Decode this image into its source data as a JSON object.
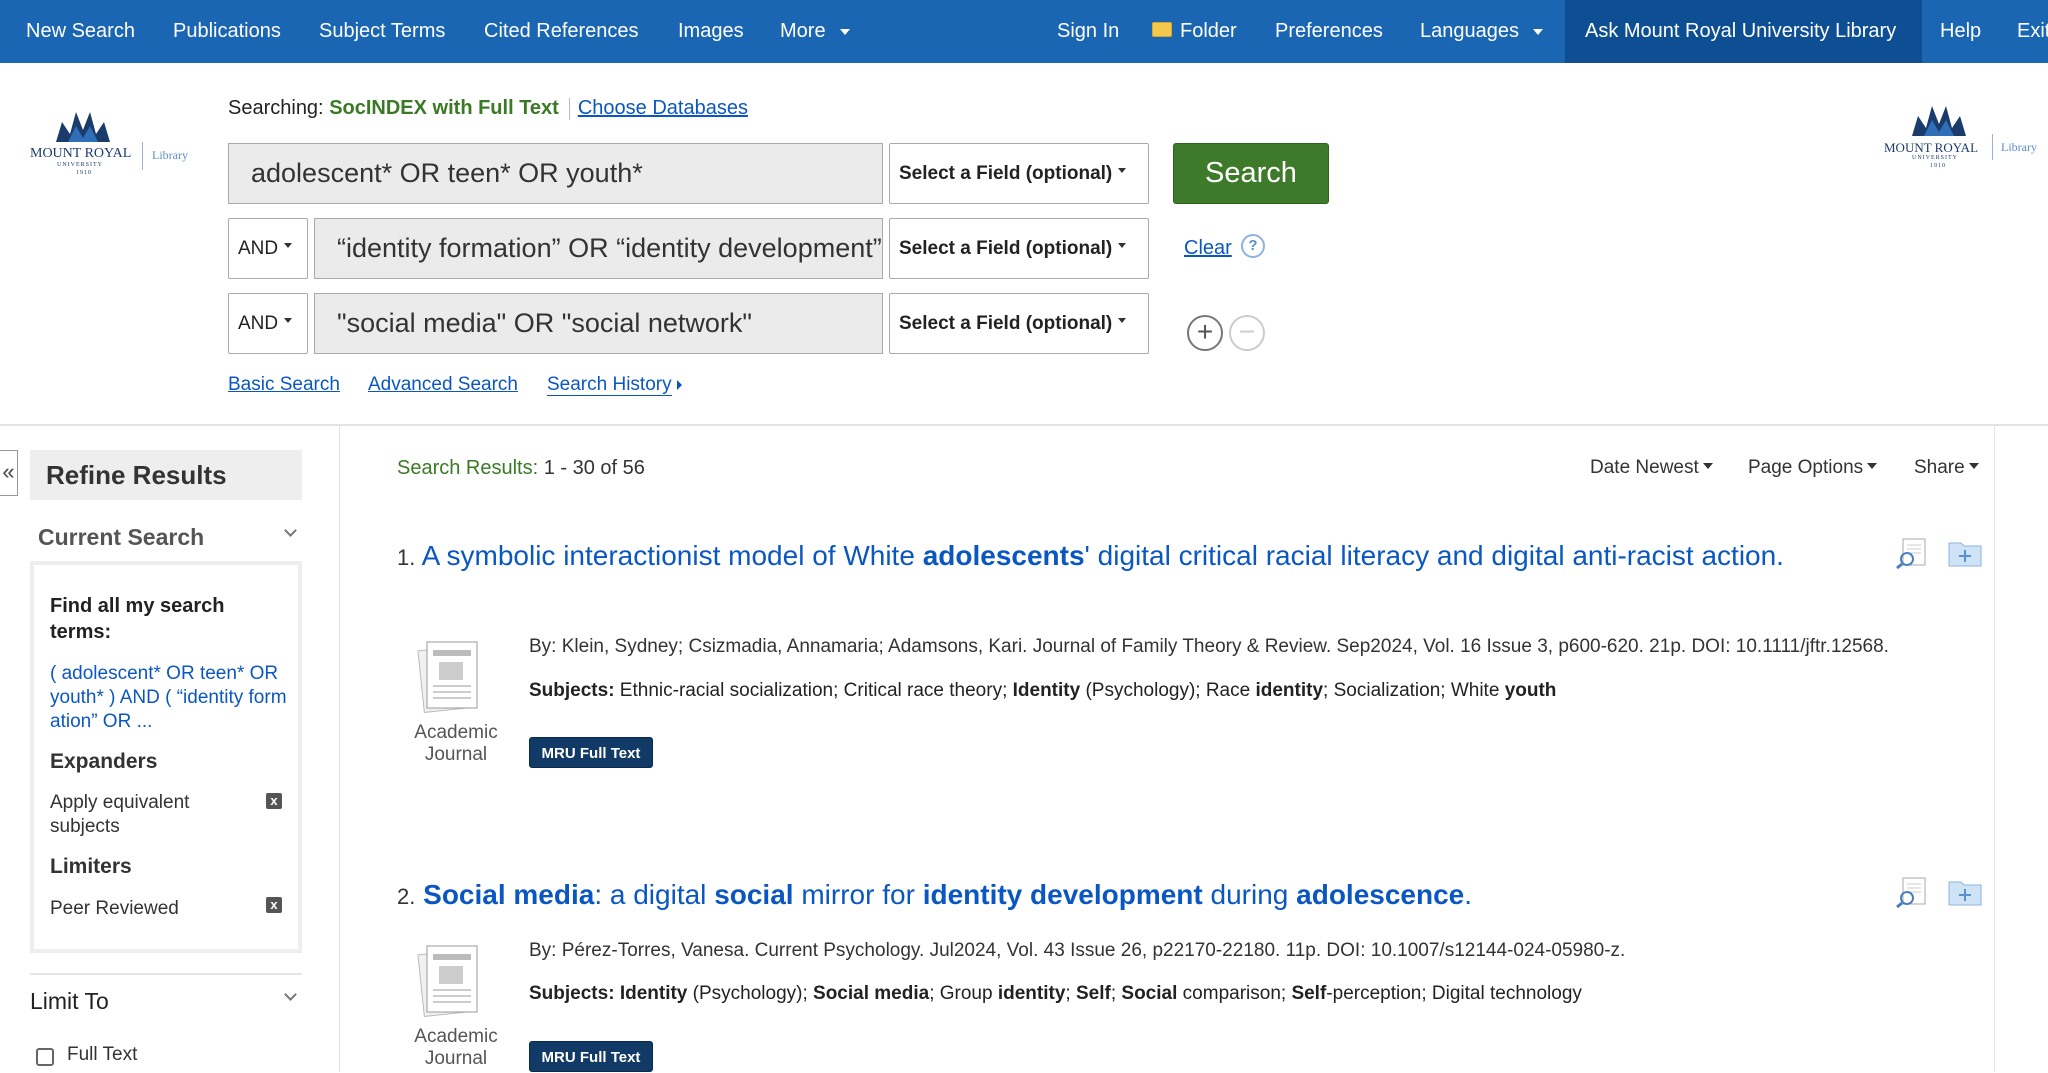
{
  "nav": {
    "left": [
      "New Search",
      "Publications",
      "Subject Terms",
      "Cited References",
      "Images",
      "More"
    ],
    "sign_in": "Sign In",
    "folder": "Folder",
    "preferences": "Preferences",
    "languages": "Languages",
    "ask": "Ask Mount Royal University Library",
    "help": "Help",
    "exit": "Exit"
  },
  "logo": {
    "name": "MOUNT ROYAL",
    "sub": "UNIVERSITY",
    "year": "1910",
    "library": "Library"
  },
  "search": {
    "searching_label": "Searching:",
    "database": "SocINDEX with Full Text",
    "choose_db": "Choose Databases",
    "rows": [
      {
        "bool": "",
        "query": "adolescent* OR teen* OR youth*",
        "field": "Select a Field (optional)"
      },
      {
        "bool": "AND",
        "query": "“identity formation” OR “identity development”",
        "field": "Select a Field (optional)"
      },
      {
        "bool": "AND",
        "query": "\"social media\" OR \"social network\"",
        "field": "Select a Field (optional)"
      }
    ],
    "search_button": "Search",
    "clear": "Clear",
    "help_mark": "?",
    "links": {
      "basic": "Basic Search",
      "advanced": "Advanced Search",
      "history": "Search History"
    }
  },
  "refine": {
    "collapse": "«",
    "title": "Refine Results",
    "current_search": "Current Search",
    "find_all_label": "Find all my search terms:",
    "query_summary": "( adolescent* OR teen* OR youth* ) AND ( “identity formation” OR ...",
    "expanders_label": "Expanders",
    "expander": "Apply equivalent subjects",
    "limiters_label": "Limiters",
    "limiter": "Peer Reviewed",
    "remove_mark": "x",
    "limit_to": "Limit To",
    "full_text": "Full Text"
  },
  "results": {
    "count_label": "Search Results:",
    "count": "1 - 30 of 56",
    "sort": "Date Newest",
    "page_options": "Page Options",
    "share": "Share",
    "items": [
      {
        "num": "1.",
        "title_parts": [
          {
            "t": "A symbolic interactionist model of White ",
            "b": false
          },
          {
            "t": "adolescents",
            "b": true
          },
          {
            "t": "' digital critical racial literacy and digital anti-racist action.",
            "b": false
          }
        ],
        "by": "By: Klein, Sydney; Csizmadia, Annamaria; Adamsons, Kari. Journal of Family Theory & Review. Sep2024, Vol. 16 Issue 3, p600-620. 21p. DOI: 10.1111/jftr.12568.",
        "subjects_label": "Subjects:",
        "subject_parts": [
          {
            "t": " Ethnic-racial socialization; Critical race theory; ",
            "b": false
          },
          {
            "t": "Identity",
            "b": true
          },
          {
            "t": " (Psychology); Race ",
            "b": false
          },
          {
            "t": "identity",
            "b": true
          },
          {
            "t": "; Socialization; White ",
            "b": false
          },
          {
            "t": "youth",
            "b": true
          }
        ],
        "doc_type": "Academic Journal",
        "badge": "MRU Full Text"
      },
      {
        "num": "2.",
        "title_parts": [
          {
            "t": "Social media",
            "b": true
          },
          {
            "t": ": a digital ",
            "b": false
          },
          {
            "t": "social",
            "b": true
          },
          {
            "t": " mirror for ",
            "b": false
          },
          {
            "t": "identity development",
            "b": true
          },
          {
            "t": " during ",
            "b": false
          },
          {
            "t": "adolescence",
            "b": true
          },
          {
            "t": ".",
            "b": false
          }
        ],
        "by": "By: Pérez-Torres, Vanesa. Current Psychology. Jul2024, Vol. 43 Issue 26, p22170-22180. 11p. DOI: 10.1007/s12144-024-05980-z.",
        "subjects_label": "Subjects:",
        "subject_parts": [
          {
            "t": " ",
            "b": false
          },
          {
            "t": "Identity",
            "b": true
          },
          {
            "t": " (Psychology); ",
            "b": false
          },
          {
            "t": "Social media",
            "b": true
          },
          {
            "t": "; Group ",
            "b": false
          },
          {
            "t": "identity",
            "b": true
          },
          {
            "t": "; ",
            "b": false
          },
          {
            "t": "Self",
            "b": true
          },
          {
            "t": "; ",
            "b": false
          },
          {
            "t": "Social",
            "b": true
          },
          {
            "t": " comparison; ",
            "b": false
          },
          {
            "t": "Self",
            "b": true
          },
          {
            "t": "-perception; Digital technology",
            "b": false
          }
        ],
        "doc_type": "Academic Journal",
        "badge": "MRU Full Text"
      }
    ]
  },
  "colors": {
    "nav": "#1a66b3",
    "nav_active": "#0e4f94",
    "search_btn": "#3d7a2a",
    "link": "#0b57c2",
    "db_green": "#3a7a25",
    "badge": "#123a66"
  }
}
